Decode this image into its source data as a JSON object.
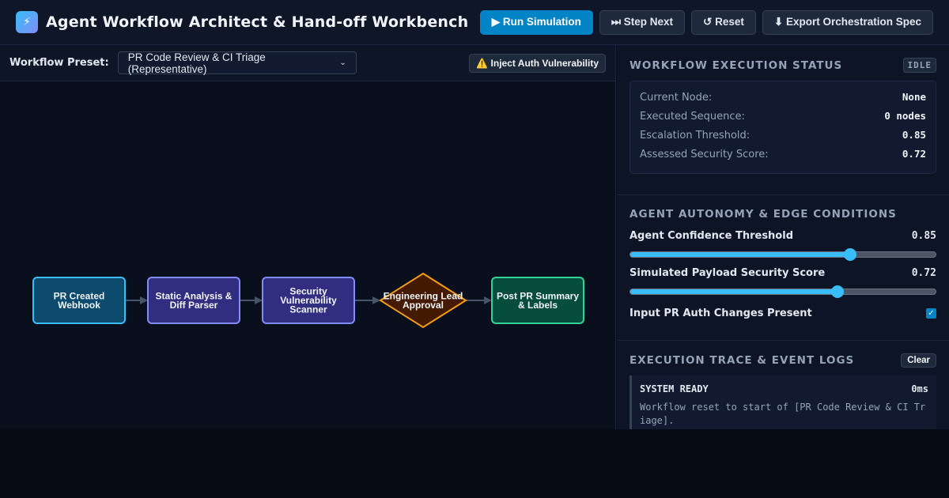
{
  "header": {
    "logo_glyph": "⚡",
    "title": "Agent Workflow Architect & Hand-off Workbench",
    "buttons": {
      "run": "▶ Run Simulation",
      "step": "⏭ Step Next",
      "reset": "↺ Reset",
      "export": "⬇ Export Orchestration Spec"
    }
  },
  "toolbar": {
    "preset_label": "Workflow Preset:",
    "preset_value": "PR Code Review & CI Triage (Representative)",
    "inject_label": "⚠️ Inject Auth Vulnerability"
  },
  "workflow": {
    "nodes": [
      {
        "lines": [
          "PR Created",
          "Webhook"
        ],
        "kind": "trigger",
        "fill": "#0c4a6e",
        "stroke": "#38bdf8"
      },
      {
        "lines": [
          "Static Analysis &",
          "Diff Parser"
        ],
        "kind": "agent",
        "fill": "#312e81",
        "stroke": "#818cf8"
      },
      {
        "lines": [
          "Security",
          "Vulnerability",
          "Scanner"
        ],
        "kind": "agent",
        "fill": "#312e81",
        "stroke": "#818cf8"
      },
      {
        "lines": [
          "Engineering Lead",
          "Approval"
        ],
        "kind": "decision",
        "fill": "#451a03",
        "stroke": "#f59e0b"
      },
      {
        "lines": [
          "Post PR Summary",
          "& Labels"
        ],
        "kind": "output",
        "fill": "#064e3b",
        "stroke": "#34d399"
      }
    ]
  },
  "status": {
    "title": "Workflow Execution Status",
    "badge": "IDLE",
    "rows": [
      {
        "key": "Current Node:",
        "value": "None"
      },
      {
        "key": "Executed Sequence:",
        "value": "0 nodes"
      },
      {
        "key": "Escalation Threshold:",
        "value": "0.85"
      },
      {
        "key": "Assessed Security Score:",
        "value": "0.72"
      }
    ]
  },
  "autonomy": {
    "title": "Agent Autonomy & Edge Conditions",
    "sliders": [
      {
        "label": "Agent Confidence Threshold",
        "value_text": "0.85",
        "fraction": 0.72
      },
      {
        "label": "Simulated Payload Security Score",
        "value_text": "0.72",
        "fraction": 0.68
      }
    ],
    "checkbox": {
      "label": "Input PR Auth Changes Present",
      "checked": true
    }
  },
  "logs": {
    "title": "Execution Trace & Event Logs",
    "clear_label": "Clear",
    "entries": [
      {
        "tag": "SYSTEM READY",
        "time": "0ms",
        "message": "Workflow reset to start of [PR Code Review & CI Triage]."
      }
    ]
  }
}
